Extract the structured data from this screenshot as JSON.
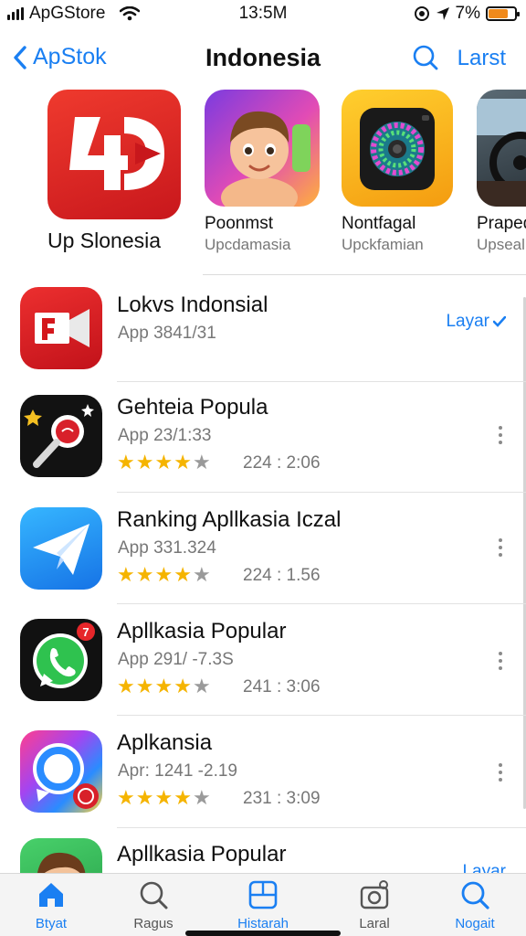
{
  "status_bar": {
    "carrier": "ApGStore",
    "time": "13:5M",
    "battery_pct": "7%",
    "battery_level": 0.75
  },
  "nav": {
    "back_label": "ApStok",
    "title": "Indonesia",
    "right_label": "Larst"
  },
  "featured": [
    {
      "name": "Up Slonesia",
      "subtitle": "",
      "icon": "4d-logo-icon"
    },
    {
      "name": "Poonmst",
      "subtitle": "Upcdamasia",
      "icon": "cartoon-boy-icon"
    },
    {
      "name": "Nontfagal",
      "subtitle": "Upckfamian",
      "icon": "camera-lens-icon"
    },
    {
      "name": "Praped",
      "subtitle": "Upseal",
      "icon": "car-interior-icon"
    }
  ],
  "list": [
    {
      "title": "Lokvs Indonsial",
      "subtitle": "App 3841/31",
      "action": "Layar",
      "icon": "video-camera-icon"
    },
    {
      "title": "Gehteia Popula",
      "subtitle": "App 23/1:33",
      "rating": 4,
      "count": "224 : 2:06",
      "icon": "microphone-icon"
    },
    {
      "title": "Ranking Apllkasia Iczal",
      "subtitle": "App 331.324",
      "rating": 4,
      "count": "224 : 1.56",
      "icon": "paper-plane-icon"
    },
    {
      "title": "Apllkasia Popular",
      "subtitle": "App 291/ -7.3S",
      "rating": 4,
      "count": "241 : 3:06",
      "badge": "7",
      "icon": "whatsapp-icon"
    },
    {
      "title": "Aplkansia",
      "subtitle": "Apr: 1241 -2.19",
      "rating": 4,
      "count": "231 : 3:09",
      "icon": "chat-bubble-icon"
    },
    {
      "title": "Apllkasia Popular",
      "action": "Layar",
      "icon": "avatar-boy-icon"
    }
  ],
  "tabbar": [
    {
      "label": "Btyat",
      "icon": "home-icon",
      "active": true
    },
    {
      "label": "Ragus",
      "icon": "search-magnifier-icon",
      "active": false
    },
    {
      "label": "Histarah",
      "icon": "grid-square-icon",
      "active": true
    },
    {
      "label": "Laral",
      "icon": "camera-icon",
      "active": false
    },
    {
      "label": "Nogait",
      "icon": "search-icon",
      "active": true
    }
  ],
  "colors": {
    "accent": "#1a7ff2",
    "star": "#f5b400",
    "battery": "#f08a1c"
  }
}
